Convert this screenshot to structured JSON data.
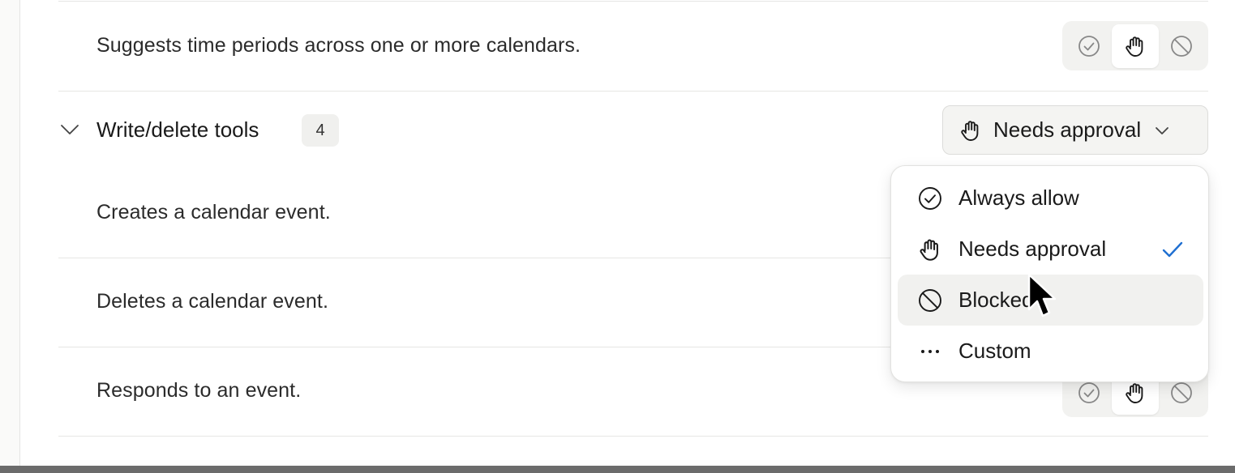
{
  "rows": [
    {
      "description": "Suggests time periods across one or more calendars."
    },
    {
      "description": "Creates a calendar event."
    },
    {
      "description": "Deletes a calendar event."
    },
    {
      "description": "Responds to an event."
    }
  ],
  "group": {
    "title": "Write/delete tools",
    "count": "4",
    "permission": "Needs approval"
  },
  "permission_menu": {
    "items": [
      {
        "label": "Always allow",
        "icon": "check-circle-icon"
      },
      {
        "label": "Needs approval",
        "icon": "hand-icon",
        "selected": true
      },
      {
        "label": "Blocked",
        "icon": "blocked-icon",
        "hovered": true
      },
      {
        "label": "Custom",
        "icon": "more-dots-icon"
      }
    ]
  },
  "colors": {
    "accent_check": "#1f6fd1",
    "hover_bg": "#f1f1ef"
  }
}
